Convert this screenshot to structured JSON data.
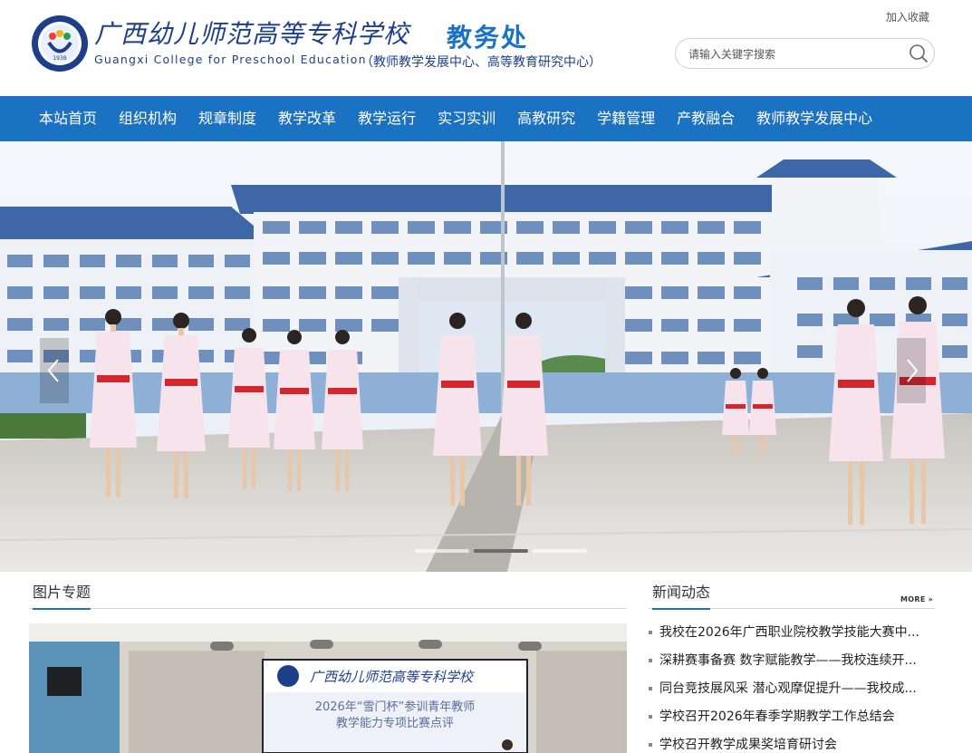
{
  "header": {
    "logo_cn": "广西幼儿师范高等专科学校",
    "logo_en": "Guangxi College for Preschool Education",
    "emblem_year": "1938",
    "dept_title": "教务处",
    "dept_subtitle": "（教师教学发展中心、高等教育研究中心）",
    "favorite_label": "加入收藏",
    "search_placeholder": "请输入关键字搜索"
  },
  "nav": {
    "items": [
      "本站首页",
      "组织机构",
      "规章制度",
      "教学改革",
      "教学运行",
      "实习实训",
      "高教研究",
      "学籍管理",
      "产教融合",
      "教师教学发展中心"
    ]
  },
  "banner": {
    "slides": 3,
    "active_slide": 2
  },
  "photo_section": {
    "title": "图片专题",
    "slide_screen_title": "2026年“雪门杯”参训青年教师",
    "slide_screen_subtitle": "教学能力专项比赛点评"
  },
  "news_section": {
    "title": "新闻动态",
    "more_label": "MORE",
    "items": [
      "我校在2026年广西职业院校教学技能大赛中...",
      "深耕赛事备赛 数字赋能教学——我校连续开...",
      "同台竞技展风采 潜心观摩促提升——我校成...",
      "学校召开2026年春季学期教学工作总结会",
      "学校召开教学成果奖培育研讨会"
    ]
  },
  "colors": {
    "accent": "#1b72c2",
    "logo_blue": "#1d3f8a"
  }
}
